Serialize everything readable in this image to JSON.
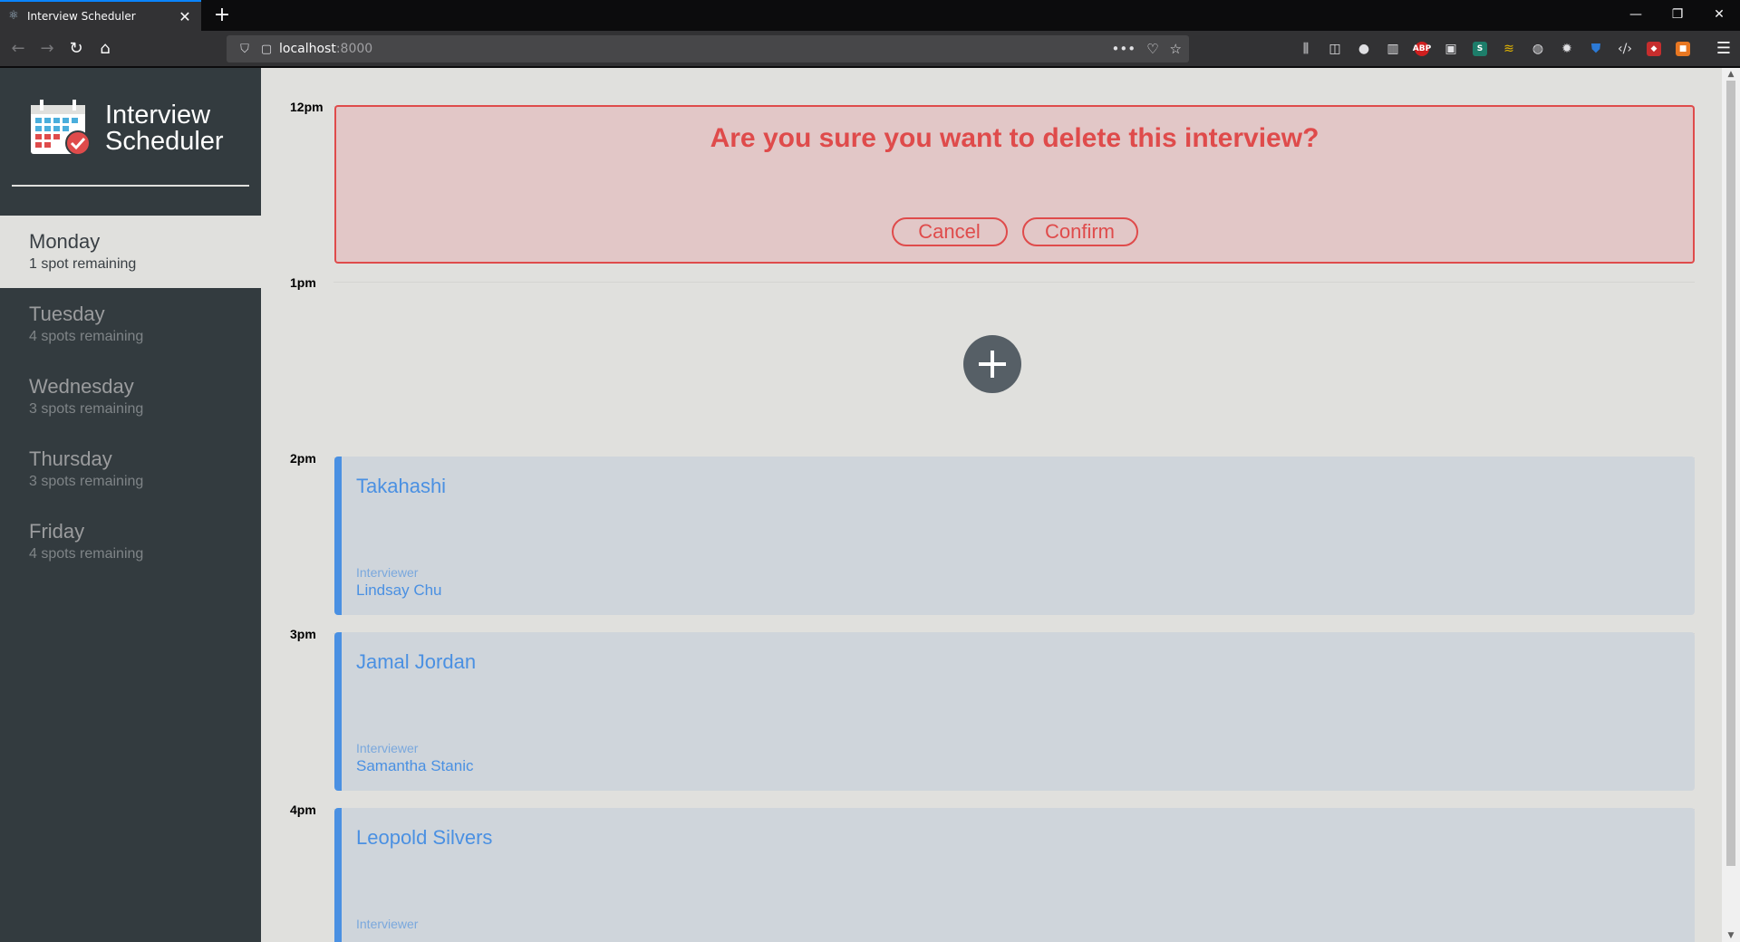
{
  "browser": {
    "tab_title": "Interview Scheduler",
    "url_host": "localhost",
    "url_port": ":8000"
  },
  "sidebar": {
    "logo_line1": "Interview",
    "logo_line2": "Scheduler",
    "days": [
      {
        "name": "Monday",
        "spots": "1 spot remaining"
      },
      {
        "name": "Tuesday",
        "spots": "4 spots remaining"
      },
      {
        "name": "Wednesday",
        "spots": "3 spots remaining"
      },
      {
        "name": "Thursday",
        "spots": "3 spots remaining"
      },
      {
        "name": "Friday",
        "spots": "4 spots remaining"
      }
    ]
  },
  "schedule": {
    "times": [
      "12pm",
      "1pm",
      "2pm",
      "3pm",
      "4pm"
    ],
    "confirm": {
      "message": "Are you sure you want to delete this interview?",
      "cancel_label": "Cancel",
      "confirm_label": "Confirm"
    },
    "appointments": [
      {
        "student": "Takahashi",
        "interviewer_label": "Interviewer",
        "interviewer": "Lindsay Chu"
      },
      {
        "student": "Jamal Jordan",
        "interviewer_label": "Interviewer",
        "interviewer": "Samantha Stanic"
      },
      {
        "student": "Leopold Silvers",
        "interviewer_label": "Interviewer",
        "interviewer": ""
      }
    ]
  },
  "colors": {
    "accent": "#4a90e2",
    "danger": "#df4b4b",
    "sidebar_bg": "#333b3f",
    "page_bg": "#e0e0dd"
  }
}
